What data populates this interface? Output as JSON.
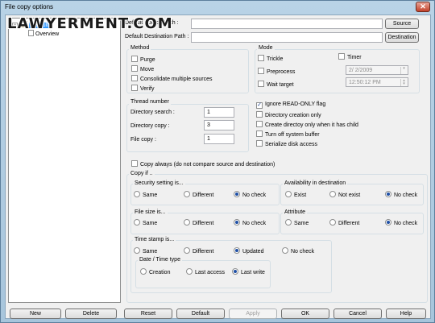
{
  "window": {
    "title": "File copy options",
    "close": "✕"
  },
  "watermark": "LAWYERMENT.COM",
  "tree": {
    "root": "Default",
    "child": "Overview",
    "expander": "−"
  },
  "paths": {
    "source_label": "Default Source Path :",
    "source_value": "",
    "source_button": "Source",
    "destination_label": "Default Destination Path :",
    "destination_value": "",
    "destination_button": "Destination"
  },
  "method": {
    "title": "Method",
    "purge": "Purge",
    "move": "Move",
    "consolidate": "Consolidate multiple sources",
    "verify": "Verify"
  },
  "mode": {
    "title": "Mode",
    "trickle": "Trickle",
    "timer": "Timer",
    "preprocess": "Preprocess",
    "wait_target": "Wait target",
    "date_value": "2/ 2/2009",
    "time_value": "12:50:12 PM"
  },
  "thread": {
    "title": "Thread number",
    "dir_search_label": "Directory search :",
    "dir_search_value": "1",
    "dir_copy_label": "Directory copy :",
    "dir_copy_value": "3",
    "file_copy_label": "File copy :",
    "file_copy_value": "1"
  },
  "options": {
    "ignore_readonly": "Ignore READ-ONLY flag",
    "dir_creation_only": "Directory creation only",
    "create_dir_child": "Create directoy only when it has child",
    "turn_off_buffer": "Turn off system buffer",
    "serialize_disk": "Serialize disk access",
    "check_mark": "✓"
  },
  "copy_always": "Copy always (do not compare source and destination)",
  "copy_if": {
    "title": "Copy if ..",
    "security": {
      "title": "Security setting is...",
      "same": "Same",
      "different": "Different",
      "no_check": "No check"
    },
    "availability": {
      "title": "Availability in destination",
      "exist": "Exist",
      "not_exist": "Not exist",
      "no_check": "No check"
    },
    "file_size": {
      "title": "File size is...",
      "same": "Same",
      "different": "Different",
      "no_check": "No check"
    },
    "attribute": {
      "title": "Attribute",
      "same": "Same",
      "different": "Different",
      "no_check": "No check"
    },
    "time_stamp": {
      "title": "Time stamp is...",
      "same": "Same",
      "different": "Different",
      "updated": "Updated",
      "no_check": "No check"
    },
    "date_time_type": {
      "title": "Date / Time type",
      "creation": "Creation",
      "last_access": "Last access",
      "last_write": "Last write"
    }
  },
  "buttons": {
    "new": "New",
    "delete": "Delete",
    "reset": "Reset",
    "default": "Default",
    "apply": "Apply",
    "ok": "OK",
    "cancel": "Cancel",
    "help": "Help"
  }
}
